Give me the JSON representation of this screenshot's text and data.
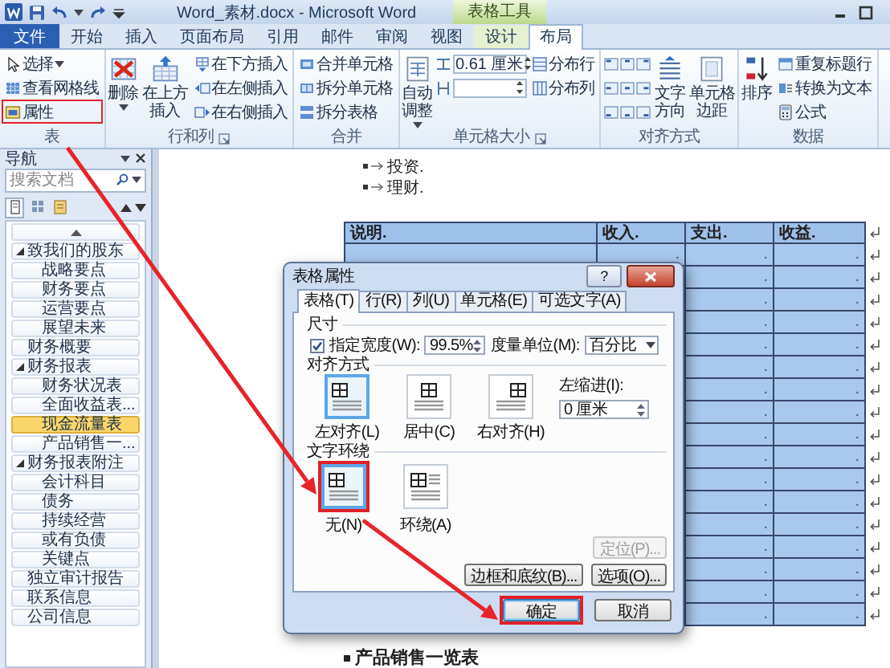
{
  "window": {
    "title": "Word_素材.docx - Microsoft Word",
    "context_tab_group": "表格工具"
  },
  "ribbon_tabs": [
    {
      "label": "文件",
      "kind": "file",
      "selected": false
    },
    {
      "label": "开始",
      "kind": "normal",
      "selected": false
    },
    {
      "label": "插入",
      "kind": "normal",
      "selected": false
    },
    {
      "label": "页面布局",
      "kind": "normal",
      "selected": false
    },
    {
      "label": "引用",
      "kind": "normal",
      "selected": false
    },
    {
      "label": "邮件",
      "kind": "normal",
      "selected": false
    },
    {
      "label": "审阅",
      "kind": "normal",
      "selected": false
    },
    {
      "label": "视图",
      "kind": "normal",
      "selected": false
    },
    {
      "label": "设计",
      "kind": "context",
      "selected": false
    },
    {
      "label": "布局",
      "kind": "context",
      "selected": true
    }
  ],
  "ribbon_groups": [
    {
      "label": "表",
      "columns": [
        {
          "kind": "stack",
          "items": [
            {
              "label": "选择",
              "dropdown": true,
              "marked": false
            },
            {
              "label": "查看网格线",
              "marked": false
            },
            {
              "label": "属性",
              "marked": true
            }
          ]
        }
      ]
    },
    {
      "label": "行和列",
      "launcher": true,
      "columns": [
        {
          "kind": "large",
          "label": "删除",
          "dropdown": true
        },
        {
          "kind": "large",
          "label": "在上方插入"
        },
        {
          "kind": "stack",
          "items": [
            {
              "label": "在下方插入"
            },
            {
              "label": "在左侧插入"
            },
            {
              "label": "在右侧插入"
            }
          ]
        }
      ]
    },
    {
      "label": "合并",
      "columns": [
        {
          "kind": "stack",
          "items": [
            {
              "label": "合并单元格"
            },
            {
              "label": "拆分单元格"
            },
            {
              "label": "拆分表格"
            }
          ]
        }
      ]
    },
    {
      "label": "单元格大小",
      "launcher": true,
      "columns": [
        {
          "kind": "large",
          "label": "自动调整",
          "dropdown": true
        },
        {
          "kind": "fields",
          "items": [
            {
              "kind": "field",
              "value": "0.61 厘米"
            },
            {
              "kind": "field"
            }
          ]
        },
        {
          "kind": "stack",
          "items": [
            {
              "label": "分布行"
            },
            {
              "label": "分布列"
            }
          ]
        }
      ]
    },
    {
      "label": "对齐方式",
      "columns": [
        {
          "kind": "align_grid"
        },
        {
          "kind": "large",
          "label": "文字方向"
        },
        {
          "kind": "large",
          "label": "单元格边距"
        }
      ]
    },
    {
      "label": "数据",
      "columns": [
        {
          "kind": "large",
          "label": "排序"
        },
        {
          "kind": "stack",
          "items": [
            {
              "label": "重复标题行"
            },
            {
              "label": "转换为文本"
            },
            {
              "label": "公式"
            }
          ]
        }
      ]
    }
  ],
  "navigation": {
    "title": "导航",
    "search": {
      "placeholder": "搜索文档"
    },
    "view_tabs": [
      {
        "selected": true
      },
      {
        "selected": false
      },
      {
        "selected": false
      }
    ],
    "headings": [
      {
        "label": "致我们的股东",
        "expanded": true,
        "selected": false,
        "children": [
          {
            "label": "战略要点",
            "selected": false
          },
          {
            "label": "财务要点",
            "selected": false
          },
          {
            "label": "运营要点",
            "selected": false
          },
          {
            "label": "展望未来",
            "selected": false
          }
        ]
      },
      {
        "label": "财务概要",
        "selected": false
      },
      {
        "label": "财务报表",
        "expanded": true,
        "selected": false,
        "children": [
          {
            "label": "财务状况表",
            "selected": false
          },
          {
            "label": "全面收益表...",
            "selected": false
          },
          {
            "label": "现金流量表",
            "selected": true
          },
          {
            "label": "产品销售一...",
            "selected": false
          }
        ]
      },
      {
        "label": "财务报表附注",
        "expanded": true,
        "selected": false,
        "children": [
          {
            "label": "会计科目",
            "selected": false
          },
          {
            "label": "债务",
            "selected": false
          },
          {
            "label": "持续经营",
            "selected": false
          },
          {
            "label": "或有负债",
            "selected": false
          },
          {
            "label": "关键点",
            "selected": false
          }
        ]
      },
      {
        "label": "独立审计报告",
        "selected": false
      },
      {
        "label": "联系信息",
        "selected": false
      },
      {
        "label": "公司信息",
        "selected": false
      }
    ]
  },
  "document": {
    "bullets": [
      "投资.",
      "理财."
    ],
    "table": {
      "columns": [
        "说明.",
        "收入.",
        "支出.",
        "收益."
      ],
      "rows": [
        {
          "cells": [
            "",
            ".",
            ".",
            "."
          ]
        },
        {
          "cells": [
            "",
            "",
            ".",
            "."
          ]
        },
        {
          "cells": [
            "",
            "",
            ".",
            "."
          ]
        },
        {
          "cells": [
            "",
            "",
            ".",
            "."
          ]
        },
        {
          "cells": [
            "",
            "",
            ".",
            "."
          ]
        },
        {
          "cells": [
            "",
            "",
            ".",
            "."
          ]
        },
        {
          "cells": [
            "",
            "",
            ".",
            "."
          ]
        },
        {
          "cells": [
            "",
            "",
            ".",
            "."
          ]
        },
        {
          "cells": [
            "",
            "",
            ".",
            "."
          ]
        },
        {
          "cells": [
            "",
            "",
            ".",
            "."
          ]
        },
        {
          "cells": [
            "",
            "",
            ".",
            "."
          ]
        },
        {
          "cells": [
            "",
            "",
            ".",
            "."
          ]
        },
        {
          "cells": [
            "",
            "",
            ".",
            "."
          ]
        },
        {
          "cells": [
            "",
            "",
            ".",
            "."
          ]
        },
        {
          "cells": [
            "",
            "",
            ".",
            "."
          ]
        },
        {
          "cells": [
            "",
            "",
            ".",
            "."
          ]
        },
        {
          "cells": [
            "",
            "",
            ".",
            "."
          ]
        }
      ]
    },
    "heading": "产品销售一览表"
  },
  "dialog": {
    "title": "表格属性",
    "help": "?",
    "tabs": [
      {
        "label": "表格(T)",
        "selected": true
      },
      {
        "label": "行(R)",
        "selected": false
      },
      {
        "label": "列(U)",
        "selected": false
      },
      {
        "label": "单元格(E)",
        "selected": false
      },
      {
        "label": "可选文字(A)",
        "selected": false
      }
    ],
    "size": {
      "title": "尺寸",
      "width_label": "指定宽度(W):",
      "width_checked": true,
      "width_value": "99.5%",
      "unit_label": "度量单位(M):",
      "unit_value": "百分比"
    },
    "alignment": {
      "title": "对齐方式",
      "options": [
        {
          "label": "左对齐(L)",
          "selected": true
        },
        {
          "label": "居中(C)",
          "selected": false
        },
        {
          "label": "右对齐(H)",
          "selected": false
        }
      ],
      "indent_label": "左缩进(I):",
      "indent_value": "0 厘米"
    },
    "wrapping": {
      "title": "文字环绕",
      "options": [
        {
          "label": "无(N)",
          "selected": true,
          "marked": true
        },
        {
          "label": "环绕(A)",
          "selected": false,
          "marked": false
        }
      ]
    },
    "position_button": {
      "label": "定位(P)...",
      "disabled": true
    },
    "panel_buttons": [
      {
        "label": "边框和底纹(B)..."
      },
      {
        "label": "选项(O)..."
      }
    ],
    "buttons": [
      {
        "label": "确定",
        "default": true,
        "marked": true
      },
      {
        "label": "取消",
        "default": false,
        "marked": false
      }
    ]
  }
}
